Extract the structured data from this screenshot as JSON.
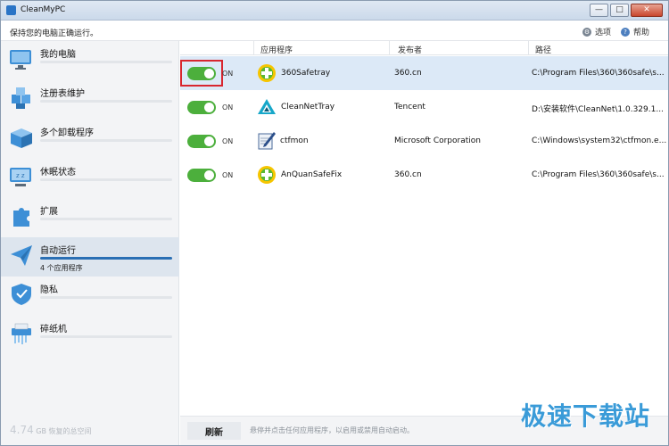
{
  "window": {
    "title": "CleanMyPC",
    "min": "—",
    "max": "□",
    "close": "✕"
  },
  "status": {
    "text": "保持您的电脑正确运行。",
    "options_label": "选项",
    "help_label": "帮助"
  },
  "sidebar": {
    "items": [
      {
        "label": "我的电脑",
        "icon": "monitor-icon"
      },
      {
        "label": "注册表维护",
        "icon": "registry-cubes-icon"
      },
      {
        "label": "多个卸载程序",
        "icon": "uninstall-box-icon"
      },
      {
        "label": "休眠状态",
        "icon": "hibernate-monitor-icon"
      },
      {
        "label": "扩展",
        "icon": "puzzle-icon"
      },
      {
        "label": "自动运行",
        "icon": "paper-plane-icon",
        "sub": "4 个应用程序",
        "progress": 1.0
      },
      {
        "label": "隐私",
        "icon": "privacy-shield-icon"
      },
      {
        "label": "碎纸机",
        "icon": "shredder-icon"
      }
    ],
    "footer_amount": "4.74",
    "footer_unit": "GB 恢复的总空间"
  },
  "table": {
    "headers": {
      "app": "应用程序",
      "publisher": "发布者",
      "path": "路径"
    },
    "rows": [
      {
        "state": "ON",
        "name": "360Safetray",
        "publisher": "360.cn",
        "path": "C:\\Program   Files\\360\\360safe\\s...",
        "icon": "360-safe-icon",
        "selected": true
      },
      {
        "state": "ON",
        "name": "CleanNetTray",
        "publisher": "Tencent",
        "path": "D:\\安装软件\\CleanNet\\1.0.329.1...",
        "icon": "cleannet-triangle-icon",
        "selected": false
      },
      {
        "state": "ON",
        "name": "ctfmon",
        "publisher": "Microsoft Corporation",
        "path": "C:\\Windows\\system32\\ctfmon.e...",
        "icon": "ctfmon-pen-icon",
        "selected": false
      },
      {
        "state": "ON",
        "name": "AnQuanSafeFix",
        "publisher": "360.cn",
        "path": "C:\\Program   Files\\360\\360safe\\s...",
        "icon": "360-safe-icon",
        "selected": false
      }
    ]
  },
  "bottom": {
    "refresh_label": "刷新",
    "hint": "悬停并点击任何应用程序，以启用或禁用自动启动。"
  },
  "watermark": "极速下载站",
  "colors": {
    "accent": "#2a6fb4",
    "toggle_on": "#4caf3c",
    "highlight": "#d8262f",
    "selected_row": "#dce9f7"
  }
}
